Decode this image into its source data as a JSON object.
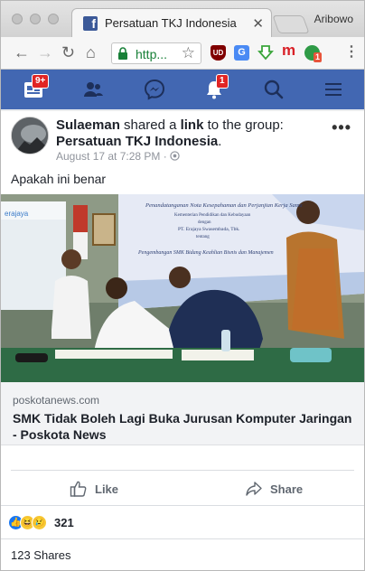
{
  "browser": {
    "tab_title": "Persatuan TKJ Indonesia",
    "profile_name": "Aribowo",
    "url_display": "http..."
  },
  "fb_nav": {
    "home_badge": "9+",
    "notifications_badge": "1"
  },
  "extensions": {
    "ublock_label": "UD",
    "translate_label": "G",
    "mega_label": "m",
    "ext_badge": "1"
  },
  "post": {
    "author": "Sulaeman",
    "shared_text": " shared a ",
    "link_word": "link",
    "to_group_text": " to the group:",
    "group_name": "Persatuan TKJ Indonesia",
    "group_suffix": ".",
    "timestamp": "August 17 at 7:28 PM",
    "meta_separator": "·",
    "body": "Apakah ini benar",
    "more_label": "•••"
  },
  "link_preview": {
    "domain": "poskotanews.com",
    "title": "SMK Tidak Boleh Lagi Buka Jurusan Komputer Jaringan - Poskota News"
  },
  "photo": {
    "banner_line1": "Penandatanganan Nota Kesepahaman dan Perjanjian Kerja Sama",
    "banner_line2": "Kementerian Pendidikan dan Kebudayaan",
    "banner_line3": "dengan",
    "banner_line4": "PT. Erajaya Swasembada, Tbk.",
    "banner_line5": "tentang",
    "banner_line6": "Pengembangan SMK Bidang Keahlian Bisnis dan Manajemen",
    "screen_label": "erajaya"
  },
  "actions": {
    "like_label": "Like",
    "share_label": "Share"
  },
  "stats": {
    "reaction_count": "321",
    "shares": "123 Shares"
  },
  "colors": {
    "fb_blue": "#4267b2",
    "link_bg": "#f2f3f5",
    "badge_red": "#e02424"
  }
}
